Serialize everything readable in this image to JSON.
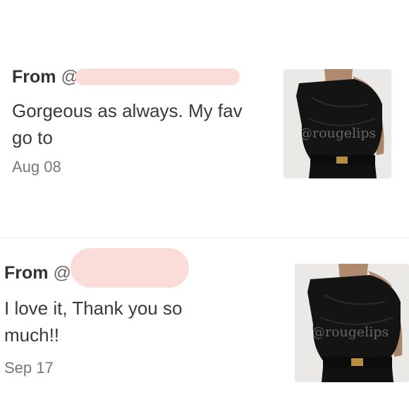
{
  "comments": [
    {
      "from_label": "From",
      "handle_visible": "@",
      "message": "Gorgeous as always. My fav go to",
      "date": "Aug 08",
      "thumbnail_watermark": "@rougelips"
    },
    {
      "from_label": "From",
      "handle_visible": "@",
      "message": "I love it, Thank you so much!!",
      "date": "Sep 17",
      "thumbnail_watermark": "@rougelips"
    }
  ]
}
